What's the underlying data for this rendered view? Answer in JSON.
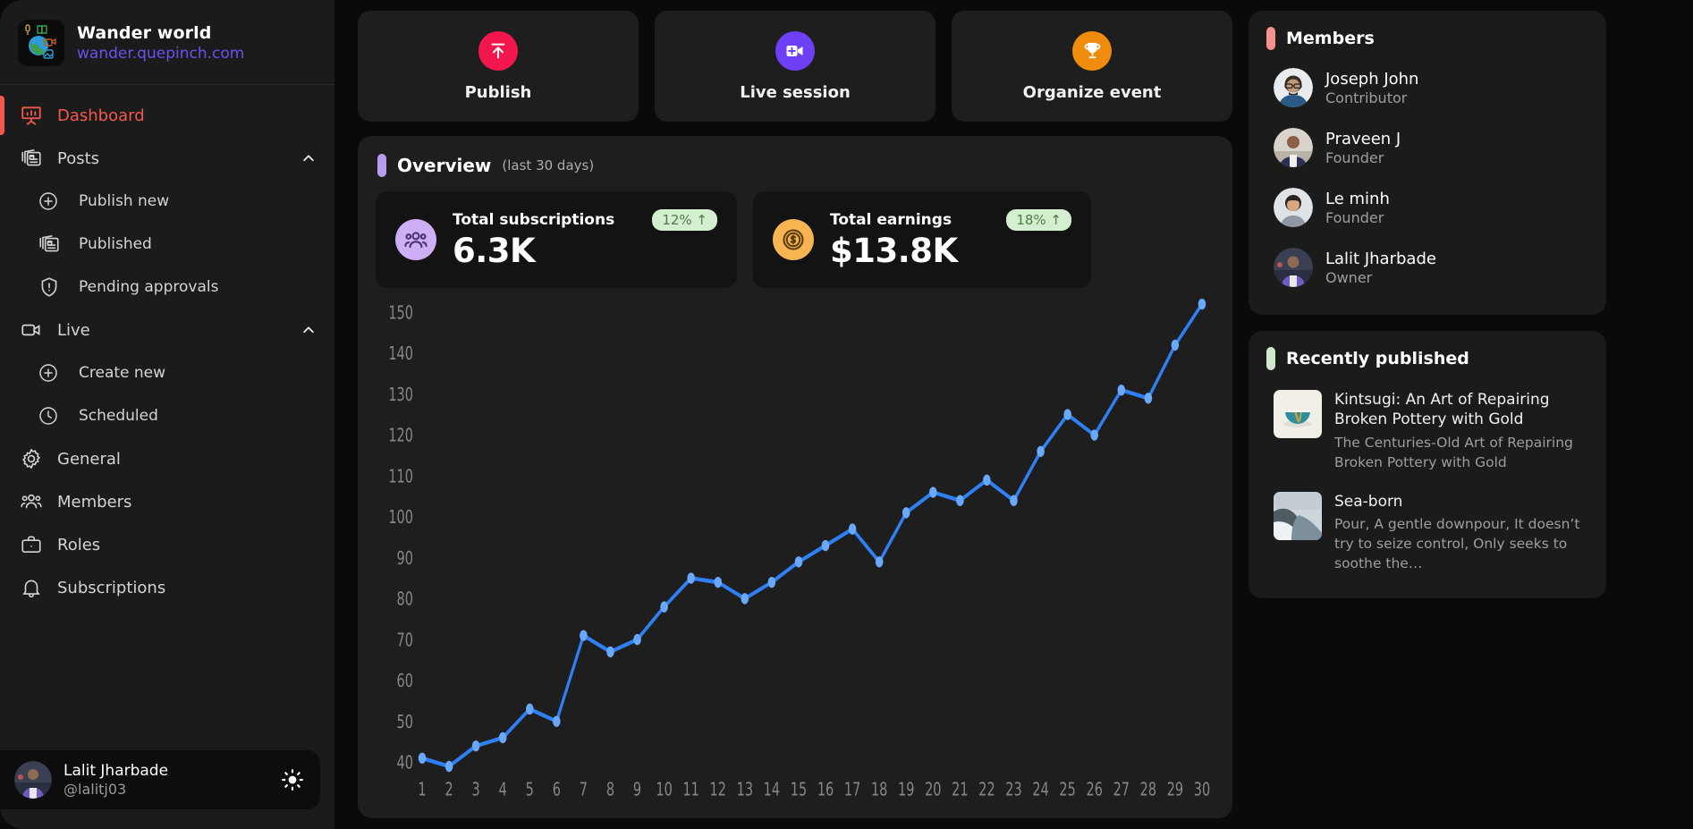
{
  "brand": {
    "name": "Wander world",
    "url": "wander.quepinch.com",
    "logo_icon": "globe-logo-icon"
  },
  "sidebar": {
    "items": [
      {
        "label": "Dashboard",
        "icon": "presentation-chart-icon",
        "level": "top",
        "active": true,
        "expandable": false
      },
      {
        "label": "Posts",
        "icon": "posts-icon",
        "level": "top",
        "active": false,
        "expandable": true,
        "expanded": true
      },
      {
        "label": "Publish new",
        "icon": "plus-circle-icon",
        "level": "sub",
        "active": false,
        "expandable": false
      },
      {
        "label": "Published",
        "icon": "posts-icon",
        "level": "sub",
        "active": false,
        "expandable": false
      },
      {
        "label": "Pending approvals",
        "icon": "shield-alert-icon",
        "level": "sub",
        "active": false,
        "expandable": false
      },
      {
        "label": "Live",
        "icon": "video-camera-icon",
        "level": "top",
        "active": false,
        "expandable": true,
        "expanded": true
      },
      {
        "label": "Create new",
        "icon": "plus-circle-icon",
        "level": "sub",
        "active": false,
        "expandable": false
      },
      {
        "label": "Scheduled",
        "icon": "clock-icon",
        "level": "sub",
        "active": false,
        "expandable": false
      },
      {
        "label": "General",
        "icon": "gear-icon",
        "level": "top",
        "active": false,
        "expandable": false
      },
      {
        "label": "Members",
        "icon": "users-icon",
        "level": "top",
        "active": false,
        "expandable": false
      },
      {
        "label": "Roles",
        "icon": "briefcase-icon",
        "level": "top",
        "active": false,
        "expandable": false
      },
      {
        "label": "Subscriptions",
        "icon": "bell-icon",
        "level": "top",
        "active": false,
        "expandable": false
      }
    ],
    "user": {
      "name": "Lalit Jharbade",
      "handle": "@lalitj03",
      "theme_toggle_icon": "sun-icon"
    },
    "active_accent": "#f2584e"
  },
  "quick_actions": [
    {
      "label": "Publish",
      "icon": "upload-icon",
      "color": "#f4174e"
    },
    {
      "label": "Live session",
      "icon": "video-plus-icon",
      "color": "#6d3ff5"
    },
    {
      "label": "Organize event",
      "icon": "trophy-icon",
      "color": "#ef8b0d"
    }
  ],
  "overview": {
    "title": "Overview",
    "subtitle": "(last 30 days)",
    "accent": "#b79cf0",
    "stats": [
      {
        "label": "Total subscriptions",
        "value": "6.3K",
        "delta": "12% ↑",
        "icon": "users-group-icon",
        "icon_bg": "#cdaff5",
        "icon_fg": "#4a3170"
      },
      {
        "label": "Total earnings",
        "value": "$13.8K",
        "delta": "18% ↑",
        "icon": "coin-dollar-icon",
        "icon_bg": "#f7b452",
        "icon_fg": "#5d3d0c"
      }
    ]
  },
  "chart_data": {
    "type": "line",
    "title": "",
    "xlabel": "",
    "ylabel": "",
    "x": [
      1,
      2,
      3,
      4,
      5,
      6,
      7,
      8,
      9,
      10,
      11,
      12,
      13,
      14,
      15,
      16,
      17,
      18,
      19,
      20,
      21,
      22,
      23,
      24,
      25,
      26,
      27,
      28,
      29,
      30
    ],
    "categories": [
      "1",
      "2",
      "3",
      "4",
      "5",
      "6",
      "7",
      "8",
      "9",
      "10",
      "11",
      "12",
      "13",
      "14",
      "15",
      "16",
      "17",
      "18",
      "19",
      "20",
      "21",
      "22",
      "23",
      "24",
      "25",
      "26",
      "27",
      "28",
      "29",
      "30"
    ],
    "values": [
      41,
      39,
      44,
      46,
      53,
      50,
      71,
      67,
      70,
      78,
      85,
      84,
      80,
      84,
      89,
      93,
      97,
      89,
      101,
      106,
      104,
      109,
      104,
      116,
      125,
      120,
      131,
      129,
      142,
      152
    ],
    "series": [
      {
        "name": "Subscriptions",
        "values": [
          41,
          39,
          44,
          46,
          53,
          50,
          71,
          67,
          70,
          78,
          85,
          84,
          80,
          84,
          89,
          93,
          97,
          89,
          101,
          106,
          104,
          109,
          104,
          116,
          125,
          120,
          131,
          129,
          142,
          152
        ]
      }
    ],
    "ylim": [
      40,
      150
    ],
    "yticks": [
      40,
      50,
      60,
      70,
      80,
      90,
      100,
      110,
      120,
      130,
      140,
      150
    ],
    "ytick_labels": [
      "40",
      "50",
      "60",
      "70",
      "80",
      "90",
      "100",
      "110",
      "120",
      "130",
      "140",
      "150"
    ],
    "grid": false,
    "legend": "none",
    "line_color": "#2f80f5",
    "marker_color": "#6aa8fb"
  },
  "members_panel": {
    "title": "Members",
    "accent": "#f4928b",
    "items": [
      {
        "name": "Joseph John",
        "role": "Contributor",
        "avatar": "avatar-joseph"
      },
      {
        "name": "Praveen J",
        "role": "Founder",
        "avatar": "avatar-praveen"
      },
      {
        "name": "Le minh",
        "role": "Founder",
        "avatar": "avatar-leminh"
      },
      {
        "name": "Lalit Jharbade",
        "role": "Owner",
        "avatar": "avatar-lalit"
      }
    ]
  },
  "recently_published_panel": {
    "title": "Recently published",
    "accent": "#cfe7cb",
    "items": [
      {
        "title": "Kintsugi: An Art of Repairing Broken Pottery with Gold",
        "desc": "The Centuries-Old Art of Repairing Broken Pottery with Gold",
        "thumb": "thumb-kintsugi-bowl"
      },
      {
        "title": "Sea-born",
        "desc": "Pour, A gentle downpour, It doesn’t try to seize control, Only seeks to soothe the…",
        "thumb": "thumb-seashore"
      }
    ]
  }
}
